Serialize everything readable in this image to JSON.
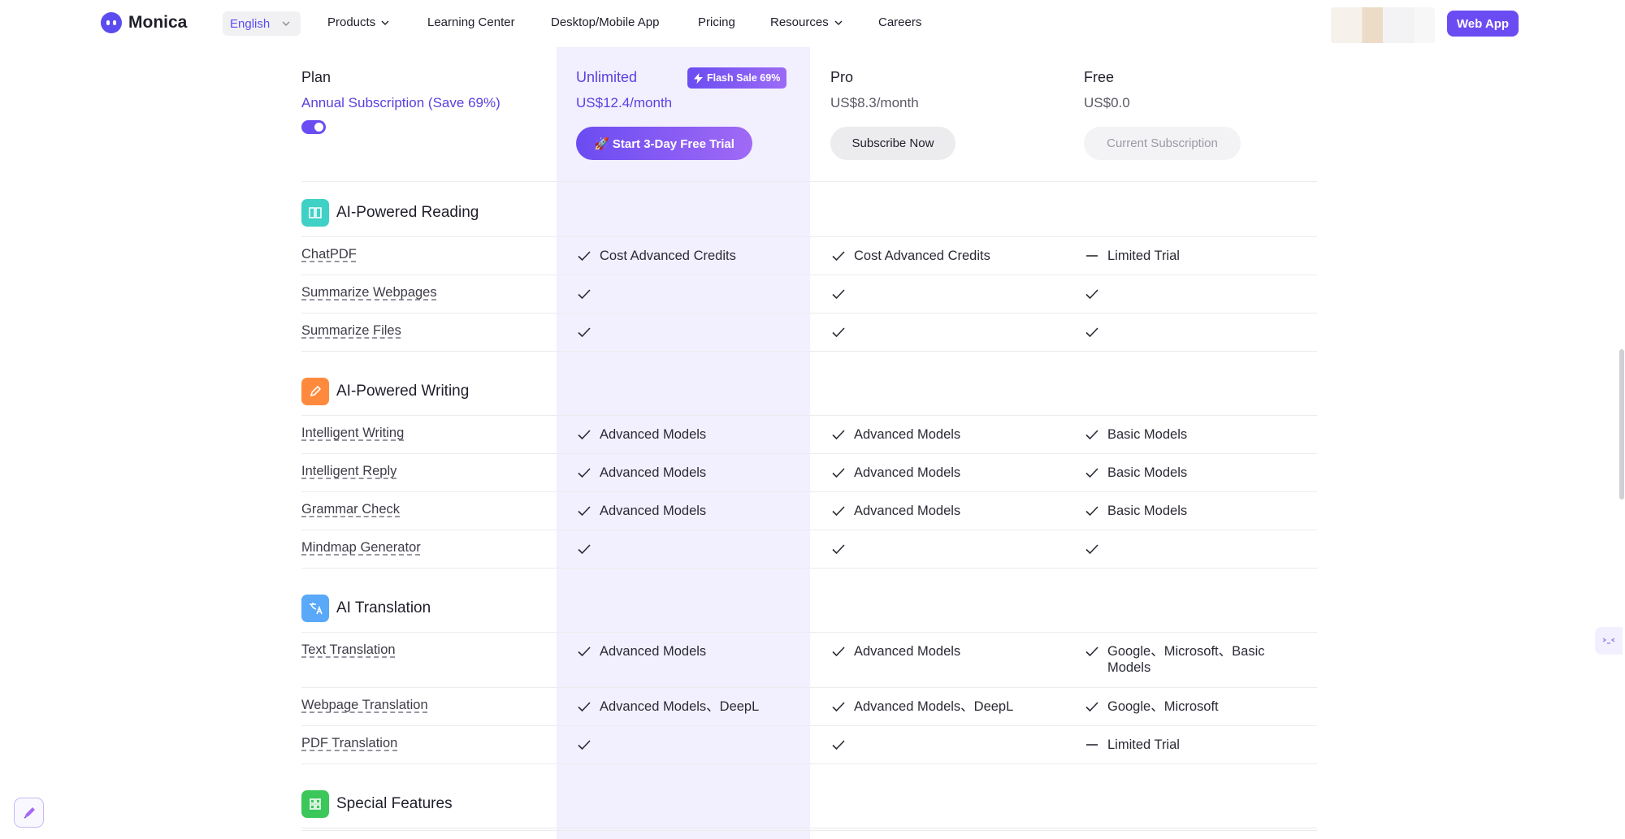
{
  "brand": {
    "name": "Monica",
    "accent": "#6b4cf2"
  },
  "nav": {
    "language": "English",
    "items": [
      {
        "label": "Products",
        "dropdown": true
      },
      {
        "label": "Learning Center",
        "dropdown": false
      },
      {
        "label": "Desktop/Mobile App",
        "dropdown": false
      },
      {
        "label": "Pricing",
        "dropdown": false
      },
      {
        "label": "Resources",
        "dropdown": true
      },
      {
        "label": "Careers",
        "dropdown": false
      }
    ],
    "cta": "Web App"
  },
  "plans_header": {
    "plan_label": "Plan",
    "billing_label": "Annual Subscription (Save 69%)",
    "annual_toggle_on": true,
    "unlimited": {
      "name": "Unlimited",
      "badge": "Flash Sale 69%",
      "price": "US$12.4/month",
      "button": "🚀 Start 3-Day Free Trial"
    },
    "pro": {
      "name": "Pro",
      "price": "US$8.3/month",
      "button": "Subscribe Now"
    },
    "free": {
      "name": "Free",
      "price": "US$0.0",
      "button": "Current Subscription"
    }
  },
  "sections": [
    {
      "title": "AI-Powered Reading",
      "icon": "book-icon",
      "color": "#3fd1c6",
      "rows": [
        {
          "feature": "ChatPDF",
          "unlimited": {
            "mark": "check",
            "text": "Cost Advanced Credits"
          },
          "pro": {
            "mark": "check",
            "text": "Cost Advanced Credits"
          },
          "free": {
            "mark": "dash",
            "text": "Limited Trial"
          }
        },
        {
          "feature": "Summarize Webpages",
          "unlimited": {
            "mark": "check",
            "text": ""
          },
          "pro": {
            "mark": "check",
            "text": ""
          },
          "free": {
            "mark": "check",
            "text": ""
          }
        },
        {
          "feature": "Summarize Files",
          "unlimited": {
            "mark": "check",
            "text": ""
          },
          "pro": {
            "mark": "check",
            "text": ""
          },
          "free": {
            "mark": "check",
            "text": ""
          }
        }
      ]
    },
    {
      "title": "AI-Powered Writing",
      "icon": "pencil-icon",
      "color": "#ff8a3d",
      "rows": [
        {
          "feature": "Intelligent Writing",
          "unlimited": {
            "mark": "check",
            "text": "Advanced Models"
          },
          "pro": {
            "mark": "check",
            "text": "Advanced Models"
          },
          "free": {
            "mark": "check",
            "text": "Basic Models"
          }
        },
        {
          "feature": "Intelligent Reply",
          "unlimited": {
            "mark": "check",
            "text": "Advanced Models"
          },
          "pro": {
            "mark": "check",
            "text": "Advanced Models"
          },
          "free": {
            "mark": "check",
            "text": "Basic Models"
          }
        },
        {
          "feature": "Grammar Check",
          "unlimited": {
            "mark": "check",
            "text": "Advanced Models"
          },
          "pro": {
            "mark": "check",
            "text": "Advanced Models"
          },
          "free": {
            "mark": "check",
            "text": "Basic Models"
          }
        },
        {
          "feature": "Mindmap Generator",
          "unlimited": {
            "mark": "check",
            "text": ""
          },
          "pro": {
            "mark": "check",
            "text": ""
          },
          "free": {
            "mark": "check",
            "text": ""
          }
        }
      ]
    },
    {
      "title": "AI Translation",
      "icon": "translate-icon",
      "color": "#5aa8f8",
      "rows": [
        {
          "feature": "Text Translation",
          "unlimited": {
            "mark": "check",
            "text": "Advanced Models"
          },
          "pro": {
            "mark": "check",
            "text": "Advanced Models"
          },
          "free": {
            "mark": "check",
            "text": "Google、Microsoft、Basic Models"
          }
        },
        {
          "feature": "Webpage Translation",
          "unlimited": {
            "mark": "check",
            "text": "Advanced Models、DeepL"
          },
          "pro": {
            "mark": "check",
            "text": "Advanced Models、DeepL"
          },
          "free": {
            "mark": "check",
            "text": "Google、Microsoft"
          }
        },
        {
          "feature": "PDF Translation",
          "unlimited": {
            "mark": "check",
            "text": ""
          },
          "pro": {
            "mark": "check",
            "text": ""
          },
          "free": {
            "mark": "dash",
            "text": "Limited Trial"
          }
        }
      ]
    },
    {
      "title": "Special Features",
      "icon": "grid-icon",
      "color": "#3cc75a",
      "rows": []
    }
  ]
}
